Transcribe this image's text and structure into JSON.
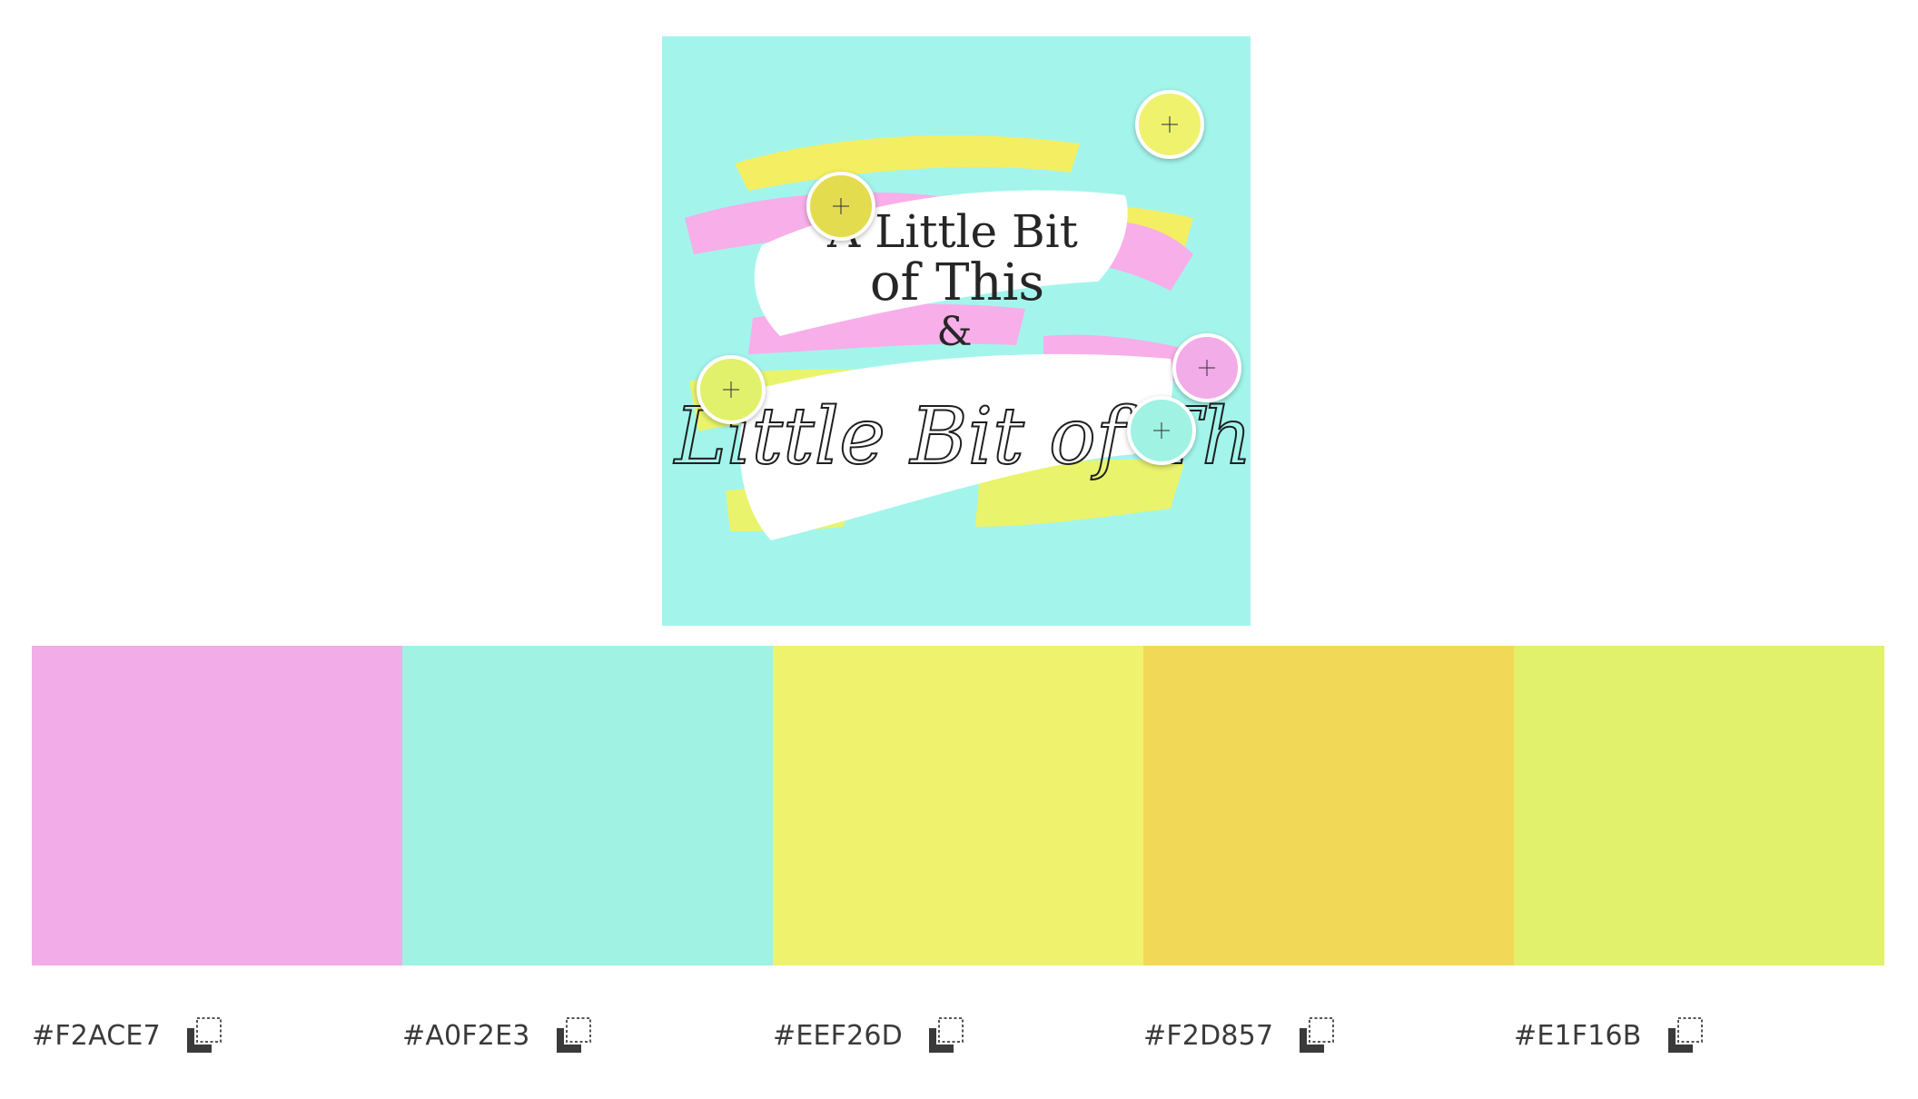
{
  "image": {
    "artwork_text": {
      "line1": "A Little Bit",
      "line2": "of This",
      "amp": "&",
      "script": "A Little Bit of That"
    },
    "background_color": "#A3F5EC"
  },
  "pickers": [
    {
      "name": "picker-1",
      "color": "#EEF26D",
      "icon": "plus-icon"
    },
    {
      "name": "picker-2",
      "color": "#E3DC4F",
      "icon": "plus-icon"
    },
    {
      "name": "picker-3",
      "color": "#E1F16B",
      "icon": "plus-icon"
    },
    {
      "name": "picker-4",
      "color": "#F2ACE7",
      "icon": "plus-icon"
    },
    {
      "name": "picker-5",
      "color": "#A0F2E3",
      "icon": "plus-icon"
    }
  ],
  "palette": [
    {
      "hex": "#F2ACE7",
      "copy_icon": "copy-icon"
    },
    {
      "hex": "#A0F2E3",
      "copy_icon": "copy-icon"
    },
    {
      "hex": "#EEF26D",
      "copy_icon": "copy-icon"
    },
    {
      "hex": "#F2D857",
      "copy_icon": "copy-icon"
    },
    {
      "hex": "#E1F16B",
      "copy_icon": "copy-icon"
    }
  ]
}
